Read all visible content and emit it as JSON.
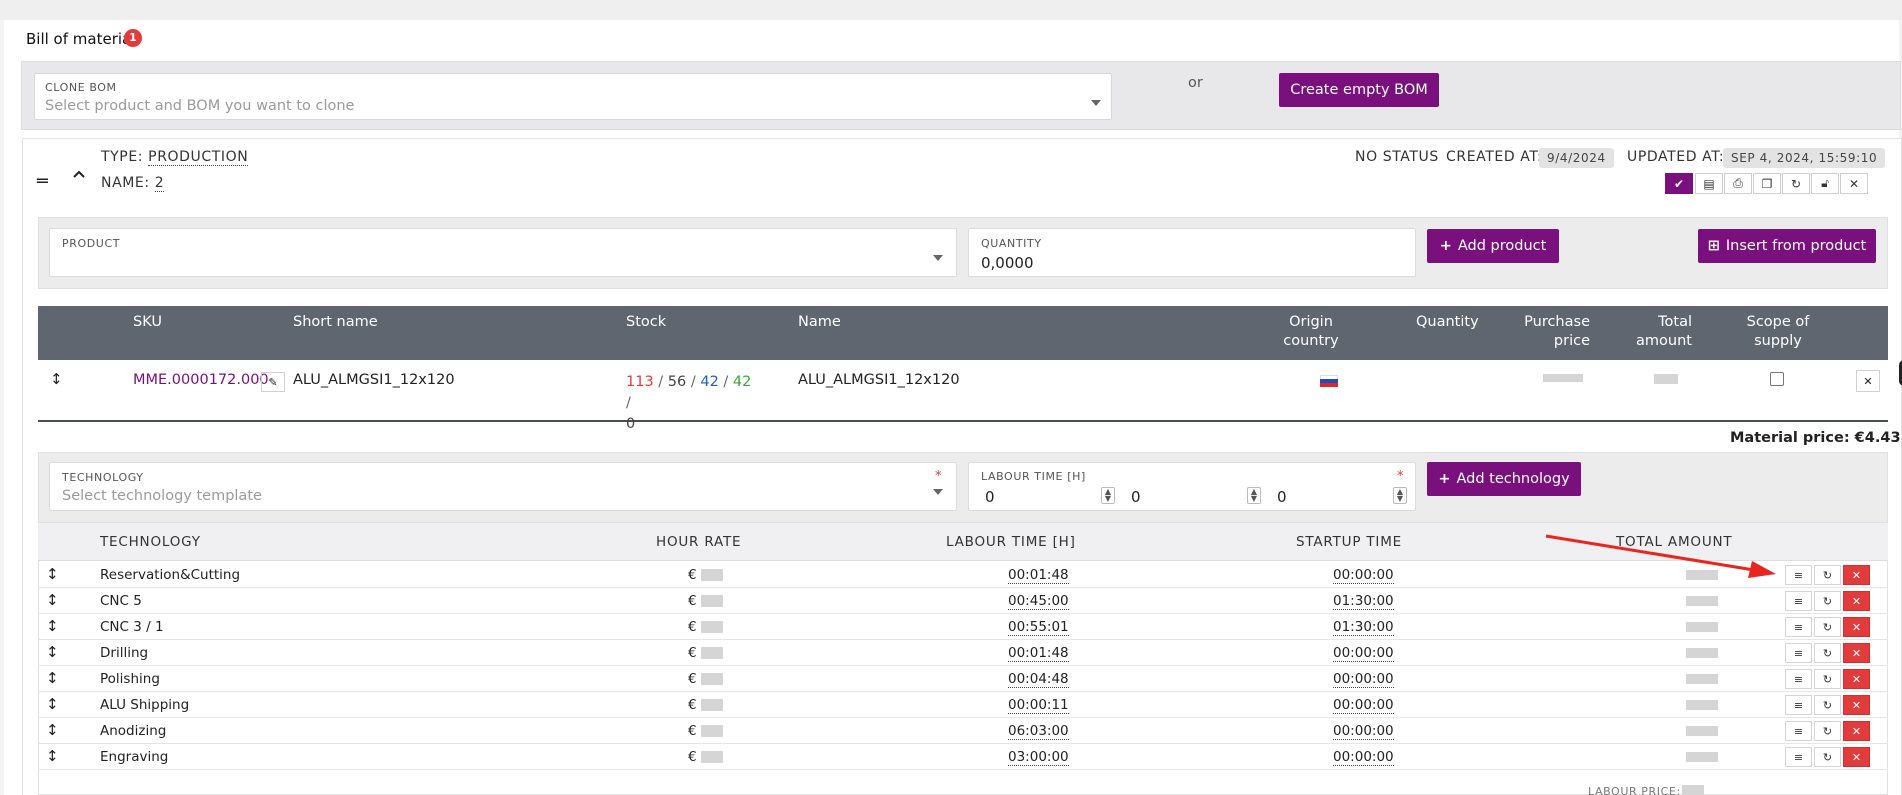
{
  "bom": {
    "title": "Bill of material",
    "badge_count": "1"
  },
  "clone": {
    "label": "CLONE BOM",
    "placeholder": "Select product and BOM you want to clone",
    "or_text": "or",
    "create_button": "Create empty BOM"
  },
  "production": {
    "type_label": "TYPE:",
    "type_value": "PRODUCTION",
    "name_label": "NAME:",
    "name_value": "2",
    "status": "NO STATUS",
    "created_label": "CREATED AT:",
    "created_value": "9/4/2024",
    "updated_label": "UPDATED AT:",
    "updated_value": "SEP 4, 2024, 15:59:10",
    "toolbar_icons": [
      "check-icon",
      "calculator-icon",
      "print-icon",
      "copy-icon",
      "refresh-icon",
      "lock-icon",
      "close-icon"
    ]
  },
  "product_form": {
    "product_label": "PRODUCT",
    "quantity_label": "QUANTITY",
    "quantity_value": "0,0000",
    "add_product": "Add product",
    "insert_from_product": "Insert from product"
  },
  "product_table": {
    "headers": {
      "sku": "SKU",
      "short_name": "Short name",
      "stock": "Stock",
      "name": "Name",
      "origin_1": "Origin",
      "origin_2": "country",
      "quantity": "Quantity",
      "purchase_1": "Purchase",
      "purchase_2": "price",
      "total_1": "Total",
      "total_2": "amount",
      "scope_1": "Scope of",
      "scope_2": "supply"
    },
    "row": {
      "sku": "MME.0000172.000",
      "short_name": "ALU_ALMGSI1_12x120",
      "stock_a": "113",
      "stock_b": "56",
      "stock_c": "42",
      "stock_d": "42",
      "stock_e": "0",
      "sep": "/",
      "name": "ALU_ALMGSI1_12x120"
    },
    "material_price": "Material price: €4.43"
  },
  "tech_form": {
    "technology_label": "TECHNOLOGY",
    "technology_placeholder": "Select technology template",
    "labour_label": "LABOUR TIME [H]",
    "labour_h": "0",
    "labour_m": "0",
    "labour_s": "0",
    "required_mark": "*",
    "add_button": "Add technology"
  },
  "tech_table": {
    "headers": {
      "technology": "TECHNOLOGY",
      "hour_rate": "HOUR RATE",
      "labour_time": "LABOUR TIME [H]",
      "startup_time": "STARTUP TIME",
      "total_amount": "TOTAL AMOUNT"
    },
    "currency": "€",
    "rows": [
      {
        "technology": "Reservation&Cutting",
        "labour": "00:01:48",
        "startup": "00:00:00"
      },
      {
        "technology": "CNC 5",
        "labour": "00:45:00",
        "startup": "01:30:00"
      },
      {
        "technology": "CNC 3 / 1",
        "labour": "00:55:01",
        "startup": "01:30:00"
      },
      {
        "technology": "Drilling",
        "labour": "00:01:48",
        "startup": "00:00:00"
      },
      {
        "technology": "Polishing",
        "labour": "00:04:48",
        "startup": "00:00:00"
      },
      {
        "technology": "ALU Shipping",
        "labour": "00:00:11",
        "startup": "00:00:00"
      },
      {
        "technology": "Anodizing",
        "labour": "06:03:00",
        "startup": "00:00:00"
      },
      {
        "technology": "Engraving",
        "labour": "03:00:00",
        "startup": "00:00:00"
      }
    ],
    "labour_price_label": "LABOUR PRICE:"
  },
  "colors": {
    "accent": "#7a0f7e",
    "danger": "#e23b3b",
    "header_dark": "#5f6670",
    "stock_red": "#e23b3b",
    "stock_blue": "#1f5fbf",
    "stock_green": "#3aa63a",
    "annotation_arrow": "#e8261e"
  }
}
